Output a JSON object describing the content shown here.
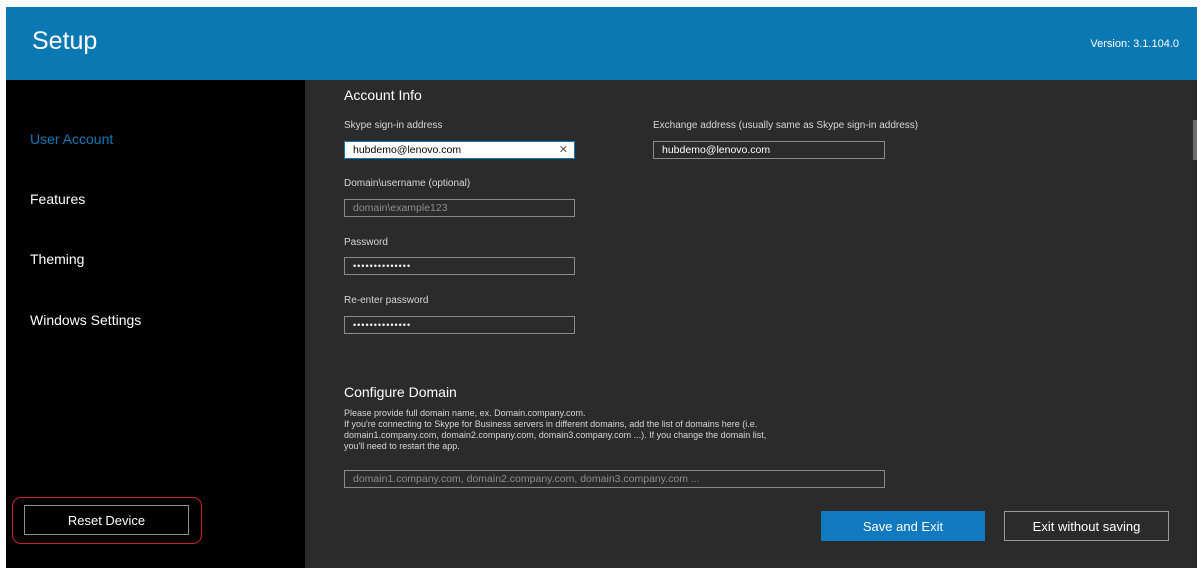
{
  "header": {
    "title": "Setup",
    "version_label": "Version:",
    "version_value": "3.1.104.0"
  },
  "sidebar": {
    "items": [
      {
        "label": "User Account",
        "active": true
      },
      {
        "label": "Features"
      },
      {
        "label": "Theming"
      },
      {
        "label": "Windows Settings"
      }
    ],
    "reset_label": "Reset Device"
  },
  "account_info": {
    "title": "Account Info",
    "skype_label": "Skype sign-in address",
    "skype_value": "hubdemo@lenovo.com",
    "exchange_label": "Exchange address (usually same as Skype sign-in address)",
    "exchange_value": "hubdemo@lenovo.com",
    "domain_user_label": "Domain\\username (optional)",
    "domain_user_placeholder": "domain\\example123",
    "password_label": "Password",
    "password_value": "••••••••••••••",
    "reenter_label": "Re-enter password",
    "reenter_value": "••••••••••••••"
  },
  "configure_domain": {
    "title": "Configure Domain",
    "description_lines": [
      "Please provide full domain name, ex. Domain.company.com.",
      "If you're connecting to Skype for Business servers in different domains, add the list of domains here (i.e.",
      "domain1.company.com, domain2.company.com, domain3.company.com ...). If you change the domain list,",
      "you'll need to restart the app."
    ],
    "domains_placeholder": "domain1.company.com, domain2.company.com, domain3.company.com ..."
  },
  "footer": {
    "save_label": "Save and Exit",
    "exit_label": "Exit without saving"
  },
  "colors": {
    "accent": "#0a78b3",
    "background": "#2b2b2b",
    "sidebar": "#000000",
    "highlight": "#c8232a"
  }
}
